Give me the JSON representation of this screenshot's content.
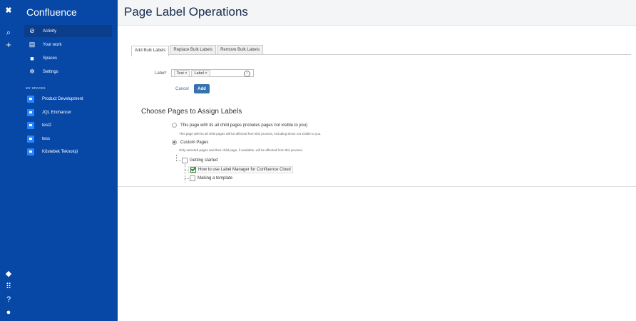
{
  "app": {
    "name": "Confluence"
  },
  "sidebar": {
    "nav": [
      {
        "label": "Activity",
        "icon": "activity-icon"
      },
      {
        "label": "Your work",
        "icon": "your-work-icon"
      },
      {
        "label": "Spaces",
        "icon": "spaces-icon"
      },
      {
        "label": "Settings",
        "icon": "settings-icon"
      }
    ],
    "section_label": "MY SPACES",
    "spaces": [
      {
        "label": "Product Development"
      },
      {
        "label": "JQL Enchancer"
      },
      {
        "label": "test2"
      },
      {
        "label": "tess"
      },
      {
        "label": "Köstebek Teknoloji"
      }
    ]
  },
  "header": {
    "title": "Page Label Operations"
  },
  "tabs": [
    {
      "label": "Add Bulk Labels",
      "active": true
    },
    {
      "label": "Replace Bulk Labels",
      "active": false
    },
    {
      "label": "Remove Bulk Labels",
      "active": false
    }
  ],
  "form": {
    "label_title": "Label",
    "required_mark": "*",
    "chips": [
      "Test",
      "Label"
    ],
    "chip_remove": "×",
    "cancel_label": "Cancel",
    "add_label": "Add"
  },
  "assign": {
    "title": "Choose Pages to Assign Labels",
    "option_all": "This page with its all child pages (includes pages not visible to you)",
    "option_all_note": "This page with its all child pages will be affected from this process, including those not visible to you.",
    "option_custom": "Custom Pages",
    "option_custom_note": "Only selected pages and their child page, if available, will be affected from this process.",
    "tree": [
      {
        "label": "Getting started",
        "checked": false
      },
      {
        "label": "How to use Label Manager for Confluence Cloud",
        "checked": true
      },
      {
        "label": "Making a template",
        "checked": false
      }
    ]
  },
  "colors": {
    "sidebar": "#0747A6",
    "accent": "#3572b0",
    "header_bg": "#F4F5F7"
  }
}
